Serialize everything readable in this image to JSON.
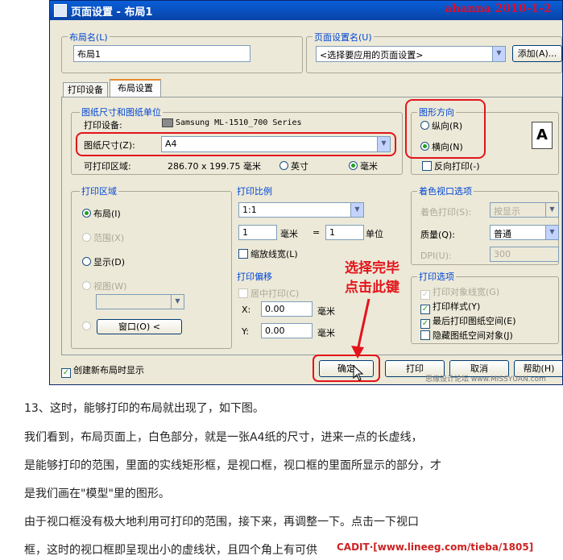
{
  "dialog": {
    "title": "页面设置 - 布局1",
    "watermark": "ahanna 2010-1-2",
    "layout_name": {
      "label": "布局名(L)",
      "value": "布局1"
    },
    "page_setup_name": {
      "label": "页面设置名(U)",
      "value": "<选择要应用的页面设置>",
      "add_button": "添加(A)..."
    },
    "tabs": [
      "打印设备",
      "布局设置"
    ],
    "paper_group": {
      "title": "图纸尺寸和图纸单位",
      "device_label": "打印设备:",
      "device_value": "Samsung ML-1510_700 Series",
      "size_label": "图纸尺寸(Z):",
      "size_value": "A4",
      "printable_label": "可打印区域:",
      "printable_value": "286.70 x 199.75 毫米",
      "unit_inch": "英寸",
      "unit_mm": "毫米"
    },
    "orientation": {
      "title": "图形方向",
      "portrait": "纵向(R)",
      "landscape": "横向(N)",
      "reverse": "反向打印(-)",
      "icon_letter": "A"
    },
    "print_area": {
      "title": "打印区域",
      "layout": "布局(I)",
      "extents": "范围(X)",
      "display": "显示(D)",
      "view": "视图(W)",
      "window_button": "窗口(O) <"
    },
    "print_scale": {
      "title": "打印比例",
      "scale_value": "1:1",
      "num_value": "1",
      "num_unit": "毫米",
      "equals": "=",
      "den_value": "1",
      "den_unit": "单位",
      "scale_lineweight": "缩放线宽(L)"
    },
    "print_offset": {
      "title": "打印偏移",
      "center": "居中打印(C)",
      "x_label": "X:",
      "x_value": "0.00",
      "x_unit": "毫米",
      "y_label": "Y:",
      "y_value": "0.00",
      "y_unit": "毫米"
    },
    "shaded_viewport": {
      "title": "着色视口选项",
      "shade_label": "着色打印(S):",
      "shade_value": "按显示",
      "quality_label": "质量(Q):",
      "quality_value": "普通",
      "dpi_label": "DPI(U):",
      "dpi_value": "300"
    },
    "plot_options": {
      "title": "打印选项",
      "lineweight": "打印对象线宽(G)",
      "plot_styles": "打印样式(Y)",
      "paperspace_last": "最后打印图纸空间(E)",
      "hide_objects": "隐藏图纸空间对象(J)"
    },
    "annotation": {
      "line1": "选择完毕",
      "line2": "点击此键"
    },
    "create_on_new": "创建新布局时显示",
    "buttons": {
      "ok": "确定",
      "print": "打印",
      "cancel": "取消",
      "help": "帮助(H)"
    },
    "bottom_watermark": "思缘设计论坛 www.MISSYUAN.com"
  },
  "article": {
    "lines": [
      "13、这时，能够打印的布局就出现了，如下图。",
      "我们看到，布局页面上，白色部分，就是一张A4纸的尺寸，进来一点的长虚线，",
      "是能够打印的范围，里面的实线矩形框，是视口框，视口框的里面所显示的部分，才",
      "是我们画在\"模型\"里的图形。",
      "由于视口框没有极大地利用可打印的范围，接下来，再调整一下。点击一下视口",
      "框，这时的视口框即呈现出小的虚线状，且四个角上有可供"
    ],
    "footer_watermark": "CADIT·[www.lineeg.com/tieba/1805]"
  }
}
